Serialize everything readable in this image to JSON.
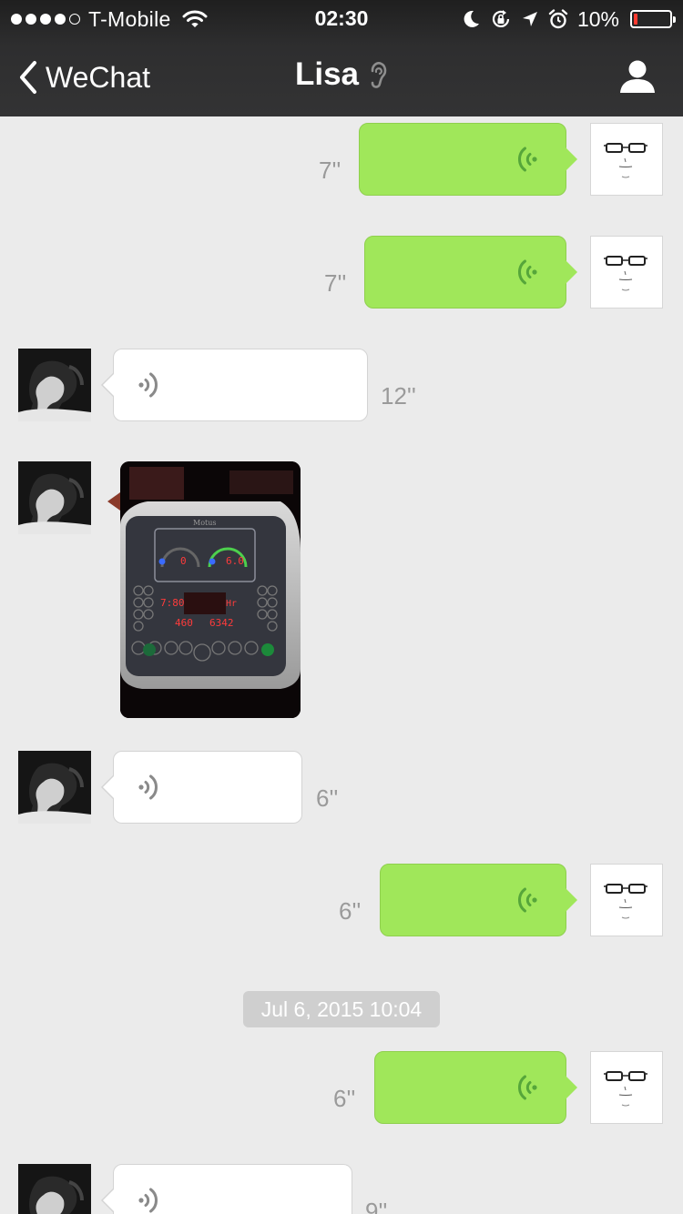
{
  "status_bar": {
    "carrier": "T-Mobile",
    "time": "02:30",
    "battery_percent": "10%",
    "battery_level": 0.1,
    "signal_bars_filled": 4,
    "signal_bars_total": 5,
    "icons": [
      "wifi-icon",
      "moon-icon",
      "rotation-lock-icon",
      "location-arrow-icon",
      "alarm-icon",
      "battery-icon"
    ]
  },
  "nav": {
    "back_label": "WeChat",
    "title": "Lisa",
    "title_icon": "earpiece-mode-icon",
    "right_icon": "profile-icon"
  },
  "messages": [
    {
      "type": "voice",
      "sender": "me",
      "duration": "7''"
    },
    {
      "type": "voice",
      "sender": "me",
      "duration": "7''"
    },
    {
      "type": "voice",
      "sender": "Lisa",
      "duration": "12''"
    },
    {
      "type": "image",
      "sender": "Lisa",
      "content": "treadmill console photo"
    },
    {
      "type": "voice",
      "sender": "Lisa",
      "duration": "6''"
    },
    {
      "type": "voice",
      "sender": "me",
      "duration": "6''"
    },
    {
      "type": "timestamp",
      "text": "Jul 6, 2015 10:04"
    },
    {
      "type": "voice",
      "sender": "me",
      "duration": "6''"
    },
    {
      "type": "voice",
      "sender": "Lisa",
      "duration": "9''"
    }
  ],
  "photo_readouts": {
    "incline": "0",
    "speed": "6.0",
    "time": "7:80",
    "unit": "Hr",
    "distance": "460",
    "calories": "6342"
  },
  "colors": {
    "outgoing_bubble": "#a0e75a",
    "incoming_bubble": "#ffffff",
    "chat_background": "#ebebeb",
    "header_background": "#333334",
    "voice_wave_out": "#56a63a",
    "voice_wave_in": "#8a8a8a",
    "battery_low": "#ff3b30"
  }
}
